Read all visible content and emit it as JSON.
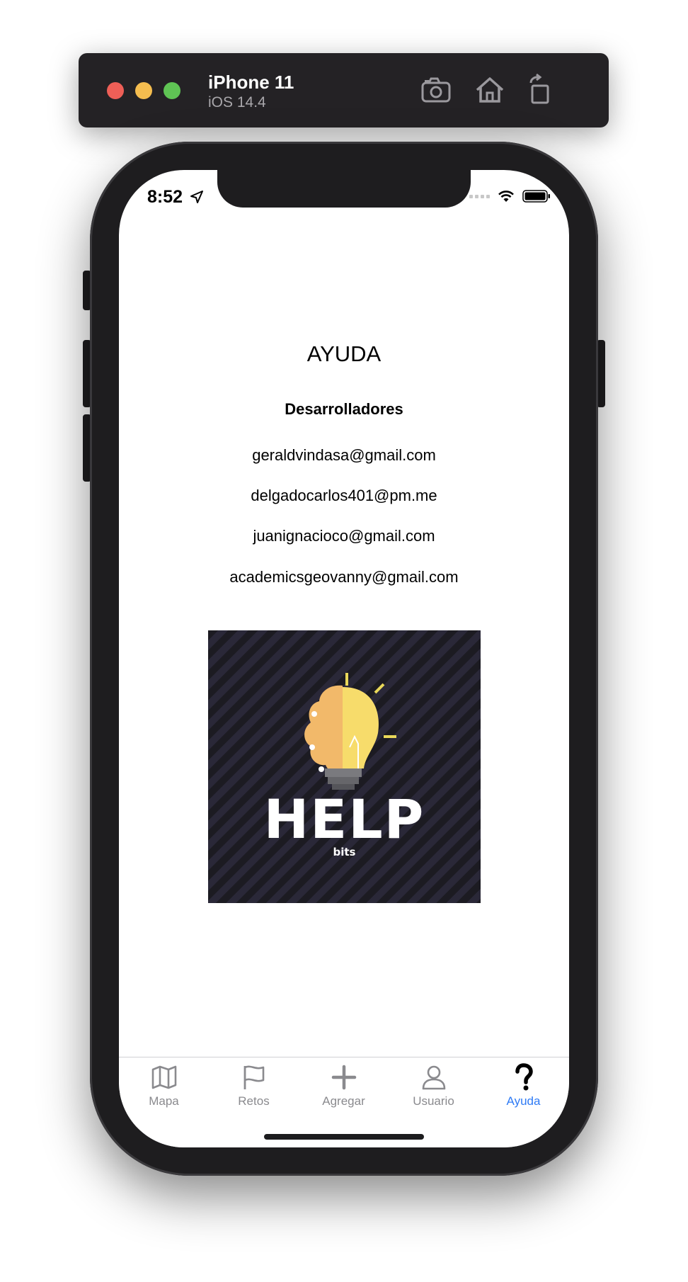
{
  "simulator": {
    "device_name": "iPhone 11",
    "os_version": "iOS 14.4",
    "icons": [
      "screenshot-icon",
      "home-icon",
      "rotate-icon"
    ]
  },
  "status_bar": {
    "time": "8:52"
  },
  "page": {
    "title": "AYUDA",
    "section_title": "Desarrolladores",
    "emails": [
      "geraldvindasa@gmail.com",
      "delgadocarlos401@pm.me",
      "juanignacioco@gmail.com",
      "academicsgeovanny@gmail.com"
    ],
    "logo": {
      "word": "HELP",
      "sub": "bits"
    }
  },
  "tabbar": {
    "tabs": [
      {
        "label": "Mapa",
        "icon": "map-icon"
      },
      {
        "label": "Retos",
        "icon": "flag-icon"
      },
      {
        "label": "Agregar",
        "icon": "plus-icon"
      },
      {
        "label": "Usuario",
        "icon": "user-icon"
      },
      {
        "label": "Ayuda",
        "icon": "question-icon"
      }
    ],
    "active_index": 4,
    "active_color": "#2f7bf5",
    "inactive_color": "#8a8a8e"
  }
}
